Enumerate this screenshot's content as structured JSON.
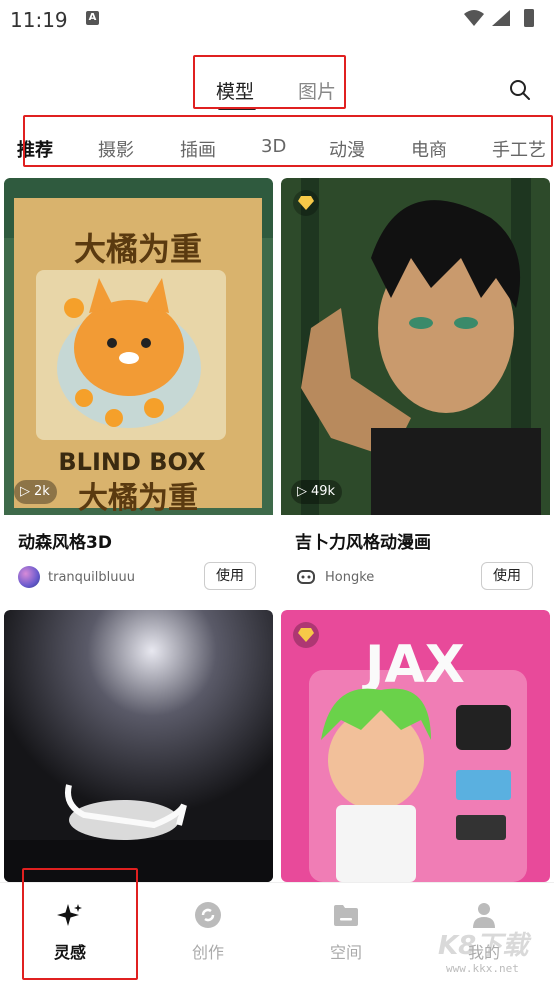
{
  "status_bar": {
    "time": "11:19",
    "notification_letter": "A"
  },
  "top_tabs": {
    "active": "模型",
    "inactive": "图片"
  },
  "categories": [
    "推荐",
    "摄影",
    "插画",
    "3D",
    "动漫",
    "电商",
    "手工艺"
  ],
  "cards": [
    {
      "title": "动森风格3D",
      "author": "tranquilbluuu",
      "plays": "2k",
      "use_label": "使用",
      "image_text_top": "大橘为重",
      "image_text_mid": "BLIND BOX",
      "image_text_bottom": "大橘为重"
    },
    {
      "title": "吉卜力风格动漫画",
      "author": "Hongke",
      "plays": "49k",
      "use_label": "使用",
      "vip": true
    },
    {
      "title": "",
      "author": "",
      "plays": ""
    },
    {
      "title": "",
      "author": "",
      "plays": "",
      "vip": true,
      "image_text_top": "JAX"
    }
  ],
  "bottom_nav": [
    {
      "label": "灵感",
      "icon": "sparkle-icon",
      "active": true
    },
    {
      "label": "创作",
      "icon": "create-icon",
      "active": false
    },
    {
      "label": "空间",
      "icon": "folder-icon",
      "active": false
    },
    {
      "label": "我的",
      "icon": "user-icon",
      "active": false
    }
  ],
  "watermark": {
    "text": "K8下载",
    "url": "www.kkx.net"
  },
  "colors": {
    "annotation_red": "#e02020",
    "active_text": "#111111",
    "inactive_text": "#aaaaaa"
  }
}
